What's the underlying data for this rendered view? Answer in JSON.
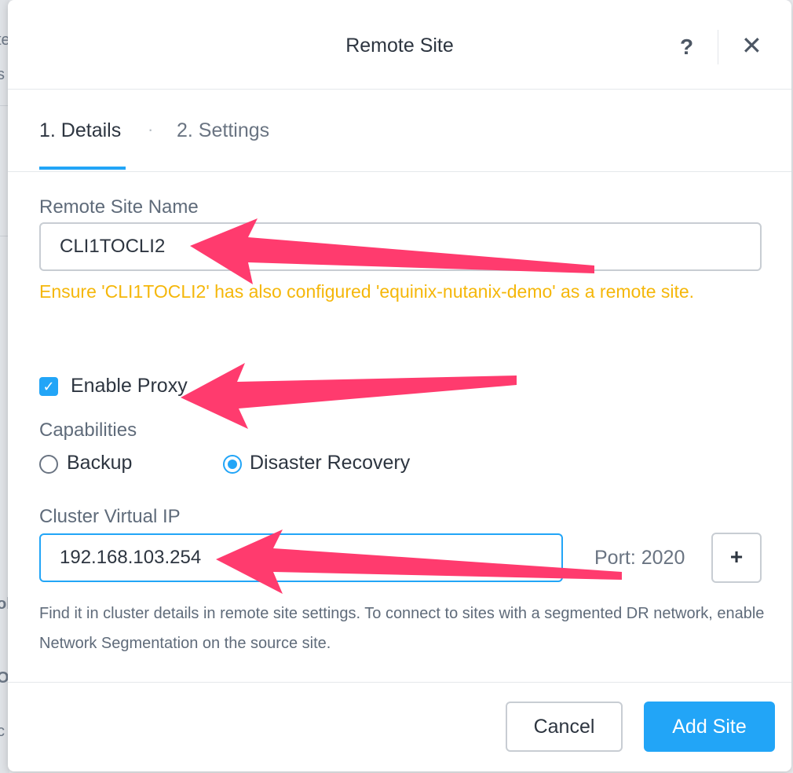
{
  "modal": {
    "title": "Remote Site",
    "help_glyph": "?",
    "close_glyph": "✕"
  },
  "tabs": [
    {
      "label": "1. Details",
      "active": true
    },
    {
      "label": "2. Settings",
      "active": false
    }
  ],
  "tab_separator": "·",
  "form": {
    "remote_site_name_label": "Remote Site Name",
    "remote_site_name_value": "CLI1TOCLI2",
    "warning": "Ensure 'CLI1TOCLI2' has also configured 'equinix-nutanix-demo' as a remote site.",
    "enable_proxy_label": "Enable Proxy",
    "enable_proxy_checked": true,
    "capabilities_label": "Capabilities",
    "capabilities": [
      {
        "label": "Backup",
        "selected": false
      },
      {
        "label": "Disaster Recovery",
        "selected": true
      }
    ],
    "cluster_vip_label": "Cluster Virtual IP",
    "cluster_vip_value": "192.168.103.254",
    "port_text": "Port: 2020",
    "add_glyph": "+",
    "help_text": "Find it in cluster details in remote site settings. To connect to sites with a segmented DR network, enable Network Segmentation on the source site."
  },
  "footer": {
    "cancel_label": "Cancel",
    "add_label": "Add Site"
  },
  "background_fragments": [
    "te",
    "s",
    "ol",
    "O",
    "c"
  ],
  "colors": {
    "accent": "#22a5f7",
    "warning": "#f5b70a",
    "annotation_arrow": "#ff3b6e"
  },
  "icons": {
    "check": "✓"
  }
}
